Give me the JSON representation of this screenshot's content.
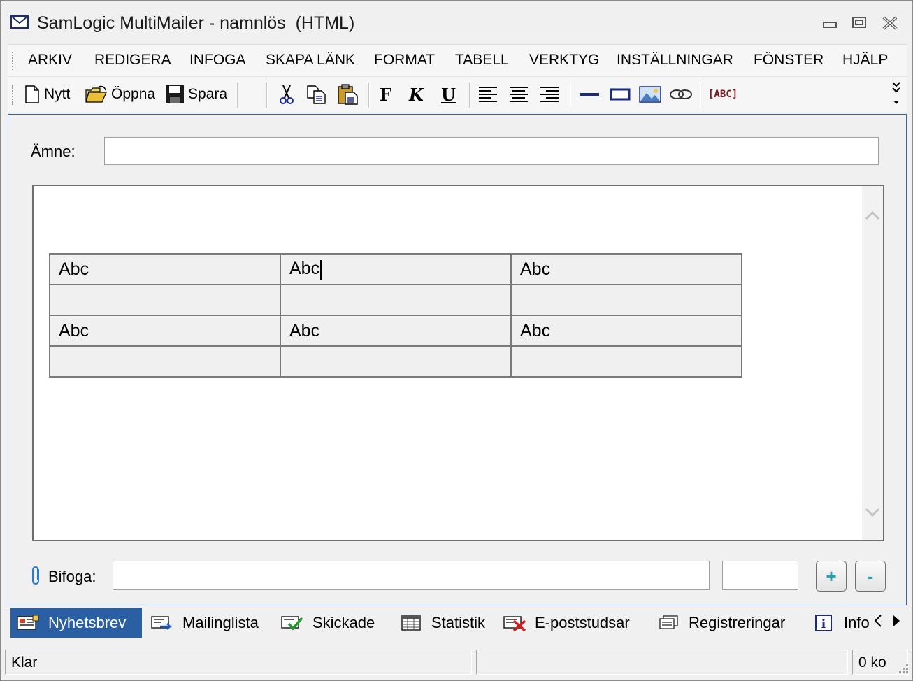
{
  "window": {
    "title": "SamLogic MultiMailer - namnlös  (HTML)",
    "icon": "envelope-icon"
  },
  "menu": {
    "items": [
      {
        "label": "ARKIV"
      },
      {
        "label": "REDIGERA"
      },
      {
        "label": "INFOGA"
      },
      {
        "label": "SKAPA LÄNK"
      },
      {
        "label": "FORMAT"
      },
      {
        "label": "TABELL"
      },
      {
        "label": "VERKTYG"
      },
      {
        "label": "INSTÄLLNINGAR"
      },
      {
        "label": "FÖNSTER"
      },
      {
        "label": "HJÄLP"
      }
    ]
  },
  "toolbar": {
    "new_label": "Nytt",
    "open_label": "Öppna",
    "save_label": "Spara",
    "bold_glyph": "F",
    "italic_glyph": "K",
    "underline_glyph": "U",
    "spell_glyph": "[ABC]"
  },
  "form": {
    "subject_label": "Ämne:",
    "subject_value": "",
    "attach_label": "Bifoga:",
    "attach_value": "",
    "attach_size": "",
    "add_label": "+",
    "remove_label": "-"
  },
  "editor": {
    "table": {
      "rows": [
        [
          "Abc",
          "Abc",
          "Abc"
        ],
        [
          "",
          "",
          ""
        ],
        [
          "Abc",
          "Abc",
          "Abc"
        ],
        [
          "",
          "",
          ""
        ]
      ]
    }
  },
  "tabs": [
    {
      "label": "Nyhetsbrev",
      "active": true
    },
    {
      "label": "Mailinglista"
    },
    {
      "label": "Skickade"
    },
    {
      "label": "Statistik"
    },
    {
      "label": "E-poststudsar"
    },
    {
      "label": "Registreringar"
    },
    {
      "label": "Info"
    }
  ],
  "status": {
    "left": "Klar",
    "middle": "",
    "right": "0 ko"
  },
  "colors": {
    "accent": "#2b5fa3",
    "frame_blue": "#2f63b0",
    "plus_minus": "#1aa3b0"
  }
}
